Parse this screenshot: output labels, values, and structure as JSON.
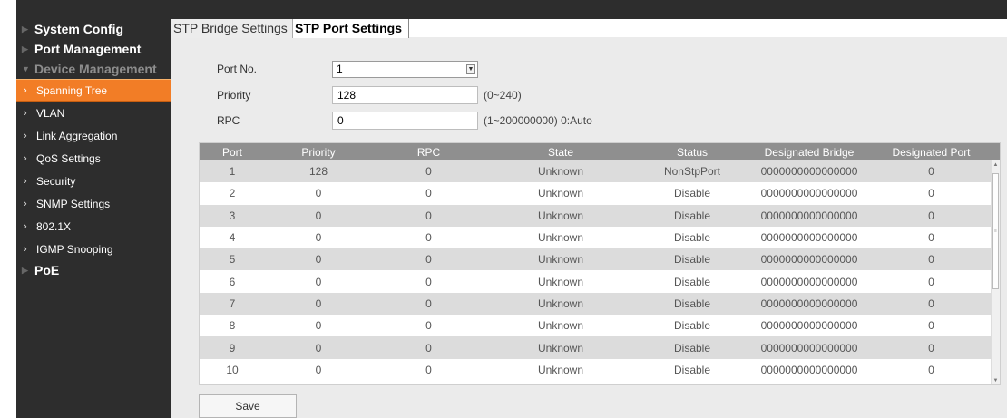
{
  "sidebar": {
    "top_items": [
      {
        "label": "System Config"
      },
      {
        "label": "Port Management"
      },
      {
        "label": "Device Management"
      }
    ],
    "sub_items": [
      {
        "label": "Spanning Tree"
      },
      {
        "label": "VLAN"
      },
      {
        "label": "Link Aggregation"
      },
      {
        "label": "QoS Settings"
      },
      {
        "label": "Security"
      },
      {
        "label": "SNMP Settings"
      },
      {
        "label": "802.1X"
      },
      {
        "label": "IGMP Snooping"
      }
    ],
    "bottom_item": {
      "label": "PoE"
    }
  },
  "tabs": [
    {
      "label": "STP Bridge Settings"
    },
    {
      "label": "STP Port Settings"
    }
  ],
  "form": {
    "port_no": {
      "label": "Port No.",
      "value": "1"
    },
    "priority": {
      "label": "Priority",
      "value": "128",
      "hint": "(0~240)"
    },
    "rpc": {
      "label": "RPC",
      "value": "0",
      "hint": "(1~200000000) 0:Auto"
    }
  },
  "table": {
    "headers": [
      "Port",
      "Priority",
      "RPC",
      "State",
      "Status",
      "Designated Bridge",
      "Designated Port"
    ],
    "rows": [
      [
        "1",
        "128",
        "0",
        "Unknown",
        "NonStpPort",
        "0000000000000000",
        "0"
      ],
      [
        "2",
        "0",
        "0",
        "Unknown",
        "Disable",
        "0000000000000000",
        "0"
      ],
      [
        "3",
        "0",
        "0",
        "Unknown",
        "Disable",
        "0000000000000000",
        "0"
      ],
      [
        "4",
        "0",
        "0",
        "Unknown",
        "Disable",
        "0000000000000000",
        "0"
      ],
      [
        "5",
        "0",
        "0",
        "Unknown",
        "Disable",
        "0000000000000000",
        "0"
      ],
      [
        "6",
        "0",
        "0",
        "Unknown",
        "Disable",
        "0000000000000000",
        "0"
      ],
      [
        "7",
        "0",
        "0",
        "Unknown",
        "Disable",
        "0000000000000000",
        "0"
      ],
      [
        "8",
        "0",
        "0",
        "Unknown",
        "Disable",
        "0000000000000000",
        "0"
      ],
      [
        "9",
        "0",
        "0",
        "Unknown",
        "Disable",
        "0000000000000000",
        "0"
      ],
      [
        "10",
        "0",
        "0",
        "Unknown",
        "Disable",
        "0000000000000000",
        "0"
      ]
    ]
  },
  "buttons": {
    "save": "Save"
  },
  "colors": {
    "accent": "#f27d26",
    "sidebar_bg": "#2d2d2d",
    "header_bg": "#8f8f8f"
  }
}
